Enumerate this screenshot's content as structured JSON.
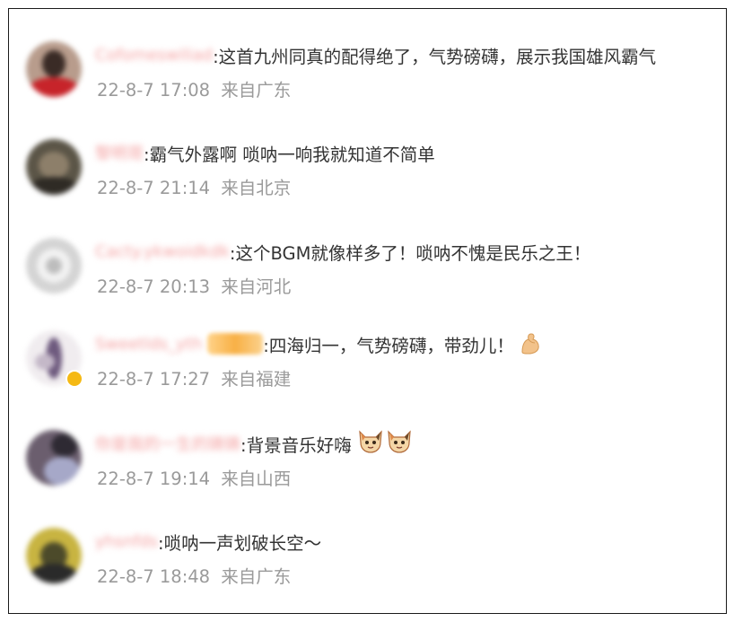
{
  "comments": [
    {
      "username": "Cofomeswiliad",
      "text": ":这首九州同真的配得绝了，气势磅礴，展示我国雄风霸气",
      "date": "22-8-7 17:08",
      "location": "来自广东",
      "avatar_colors": [
        "#b89c8c",
        "#3a2b26",
        "#c7242a"
      ]
    },
    {
      "username": "黎明哥",
      "text": ":霸气外露啊 唢呐一响我就知道不简单",
      "date": "22-8-7 21:14",
      "location": "来自北京",
      "avatar_colors": [
        "#5b5547",
        "#8d7f6a",
        "#2f2b25"
      ]
    },
    {
      "username": "Cacty.ykwoidkdk",
      "text": ":这个BGM就像样多了！唢呐不愧是民乐之王！",
      "date": "22-8-7 20:13",
      "location": "来自河北",
      "avatar_colors": [
        "#d4d4d4",
        "#f2f2f2",
        "#bdbdbd"
      ]
    },
    {
      "username": "Sweetlds_yth",
      "text": ":四海归一，气势磅礴，带劲儿！",
      "date": "22-8-7 17:27",
      "location": "来自福建",
      "avatar_colors": [
        "#f0ecef",
        "#6e5a7e",
        "#c4b8c8"
      ],
      "has_vip_badge": true,
      "has_verified_badge": true,
      "emoji": [
        "flexed-biceps-emoji"
      ]
    },
    {
      "username": "你是我的一生的铸铸",
      "text": ":背景音乐好嗨",
      "date": "22-8-7 19:14",
      "location": "来自山西",
      "avatar_colors": [
        "#6b5e6e",
        "#a6a8c8",
        "#2e2a33"
      ],
      "emoji": [
        "cat-face-emoji",
        "cat-face-emoji"
      ]
    },
    {
      "username": "yhsnfds",
      "text": ":唢呐一声划破长空～",
      "date": "22-8-7 18:48",
      "location": "来自广东",
      "avatar_colors": [
        "#c8b441",
        "#4c4a2a",
        "#2a2a2a"
      ]
    }
  ]
}
